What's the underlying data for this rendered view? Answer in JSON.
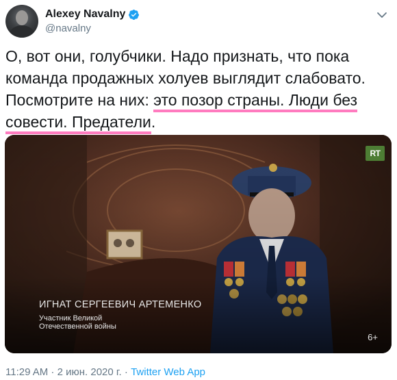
{
  "author": {
    "name": "Alexey Navalny",
    "handle": "@navalny",
    "verified_color": "#1da1f2"
  },
  "tweet": {
    "text_part1": "О, вот они, голубчики. Надо признать, что пока команда продажных холуев выглядит слабовато. Посмотрите на них: ",
    "highlight1": "это позор страны. Люди без",
    "highlight2": "совести. Предатели",
    "text_end": ".",
    "highlight_color": "#ff7bbf"
  },
  "video": {
    "channel_badge": "RT",
    "caption_name": "ИГНАТ СЕРГЕЕВИЧ АРТЕМЕНКО",
    "caption_subtitle": "Участник Великой Отечественной войны",
    "age_rating": "6+"
  },
  "meta": {
    "time": "11:29 AM",
    "separator1": " · ",
    "date": "2 июн. 2020 г.",
    "separator2": " · ",
    "app": "Twitter Web App"
  }
}
